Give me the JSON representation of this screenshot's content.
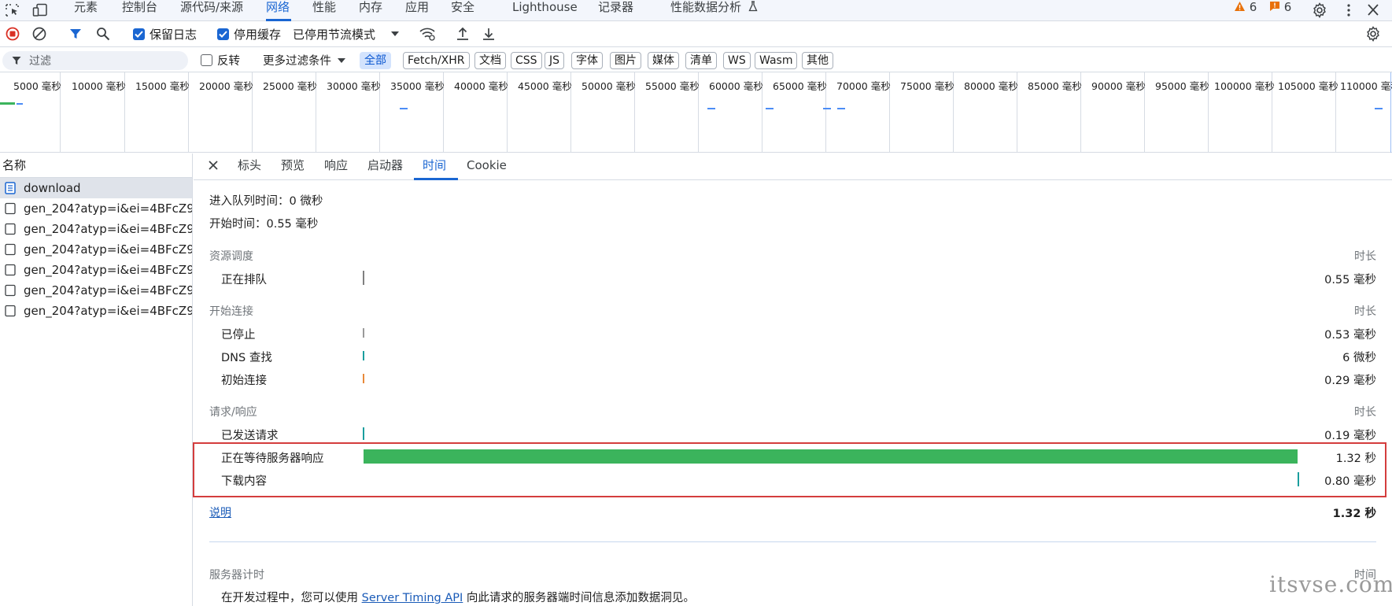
{
  "top_tabs": [
    {
      "label": "元素"
    },
    {
      "label": "控制台"
    },
    {
      "label": "源代码/来源"
    },
    {
      "label": "网络"
    },
    {
      "label": "性能"
    },
    {
      "label": "内存"
    },
    {
      "label": "应用"
    },
    {
      "label": "安全"
    },
    {
      "label": "Lighthouse"
    },
    {
      "label": "记录器"
    },
    {
      "label": "性能数据分析"
    }
  ],
  "active_top_tab": "网络",
  "top_right": {
    "warnings_count": "6",
    "issues_count": "6"
  },
  "toolbar": {
    "preserve_log_label": "保留日志",
    "disable_cache_label": "停用缓存",
    "throttling_value": "已停用节流模式"
  },
  "filter_bar": {
    "filter_placeholder": "过滤",
    "invert_label": "反转",
    "more_filters_label": "更多过滤条件",
    "chips": [
      "全部",
      "Fetch/XHR",
      "文档",
      "CSS",
      "JS",
      "字体",
      "图片",
      "媒体",
      "清单",
      "WS",
      "Wasm",
      "其他"
    ],
    "active_chip": "全部"
  },
  "overview": {
    "tick_labels": [
      "5000 毫秒",
      "10000 毫秒",
      "15000 毫秒",
      "20000 毫秒",
      "25000 毫秒",
      "30000 毫秒",
      "35000 毫秒",
      "40000 毫秒",
      "45000 毫秒",
      "50000 毫秒",
      "55000 毫秒",
      "60000 毫秒",
      "65000 毫秒",
      "70000 毫秒",
      "75000 毫秒",
      "80000 毫秒",
      "85000 毫秒",
      "90000 毫秒",
      "95000 毫秒",
      "100000 毫秒",
      "105000 毫秒",
      "110000 毫秒"
    ]
  },
  "request_list": {
    "header": "名称",
    "items": [
      {
        "name": "download",
        "selected": true
      },
      {
        "name": "gen_204?atyp=i&ei=4BFcZ9..."
      },
      {
        "name": "gen_204?atyp=i&ei=4BFcZ9..."
      },
      {
        "name": "gen_204?atyp=i&ei=4BFcZ9..."
      },
      {
        "name": "gen_204?atyp=i&ei=4BFcZ9..."
      },
      {
        "name": "gen_204?atyp=i&ei=4BFcZ9..."
      },
      {
        "name": "gen_204?atyp=i&ei=4BFcZ9..."
      }
    ]
  },
  "detail_tabs": [
    "标头",
    "预览",
    "响应",
    "启动器",
    "时间",
    "Cookie"
  ],
  "active_detail_tab": "时间",
  "timing": {
    "queued_at": "进入队列时间：0 微秒",
    "started_at": "开始时间：0.55 毫秒",
    "duration_header": "时长",
    "sections": [
      {
        "title": "资源调度",
        "rows": [
          {
            "label": "正在排队",
            "value": "0.55 毫秒"
          }
        ]
      },
      {
        "title": "开始连接",
        "rows": [
          {
            "label": "已停止",
            "value": "0.53 毫秒"
          },
          {
            "label": "DNS 查找",
            "value": "6 微秒"
          },
          {
            "label": "初始连接",
            "value": "0.29 毫秒"
          }
        ]
      },
      {
        "title": "请求/响应",
        "rows": [
          {
            "label": "已发送请求",
            "value": "0.19 毫秒"
          },
          {
            "label": "正在等待服务器响应",
            "value": "1.32 秒"
          },
          {
            "label": "下载内容",
            "value": "0.80 毫秒"
          }
        ]
      }
    ],
    "explanation_link": "说明",
    "total": "1.32 秒",
    "server_timing": {
      "title": "服务器计时",
      "duration_header": "时间",
      "desc_before": "在开发过程中，您可以使用 ",
      "desc_link": "Server Timing API",
      "desc_after": " 向此请求的服务器端时间信息添加数据洞见。"
    }
  },
  "watermark": "itsvse.com",
  "colors": {
    "accent": "#1a66d2",
    "waiting_bar": "#3bb45c",
    "highlight_border": "#d43d3d"
  }
}
